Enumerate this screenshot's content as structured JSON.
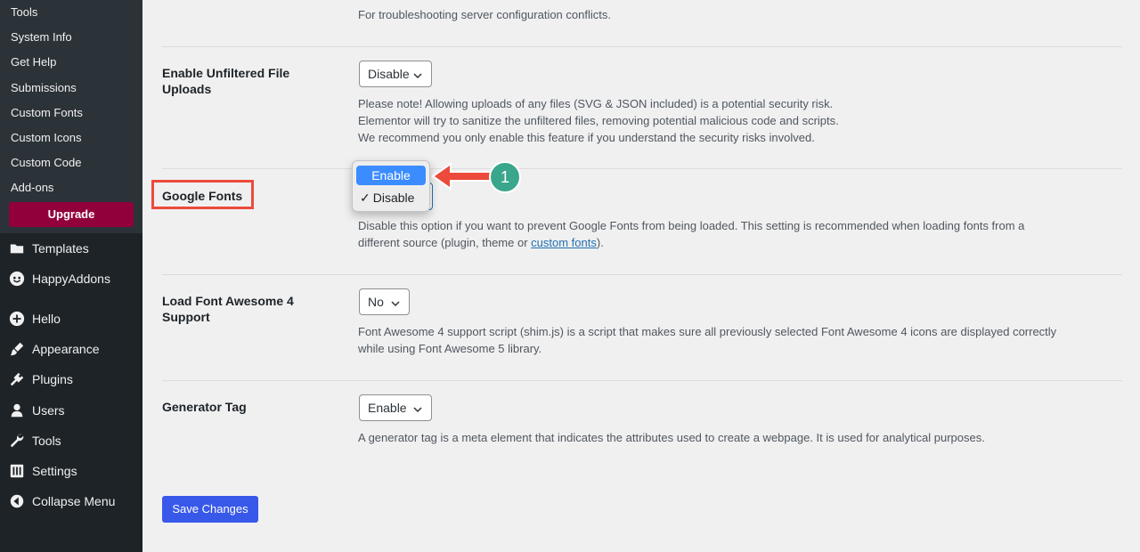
{
  "sidebar": {
    "submenu": [
      "Tools",
      "System Info",
      "Get Help",
      "Submissions",
      "Custom Fonts",
      "Custom Icons",
      "Custom Code",
      "Add-ons"
    ],
    "upgrade_label": "Upgrade",
    "menu": [
      {
        "label": "Templates",
        "icon": "folder-icon"
      },
      {
        "label": "HappyAddons",
        "icon": "happyaddons-icon"
      },
      {
        "label": "Hello",
        "icon": "plus-circle-icon"
      },
      {
        "label": "Appearance",
        "icon": "paintbrush-icon"
      },
      {
        "label": "Plugins",
        "icon": "plugin-icon"
      },
      {
        "label": "Users",
        "icon": "user-icon"
      },
      {
        "label": "Tools",
        "icon": "wrench-icon"
      },
      {
        "label": "Settings",
        "icon": "settings-icon"
      },
      {
        "label": "Collapse Menu",
        "icon": "collapse-icon"
      }
    ]
  },
  "settings": {
    "top_desc": "For troubleshooting server configuration conflicts.",
    "unfiltered": {
      "label": "Enable Unfiltered File Uploads",
      "value": "Disable",
      "desc1": "Please note! Allowing uploads of any files (SVG & JSON included) is a potential security risk.",
      "desc2": "Elementor will try to sanitize the unfiltered files, removing potential malicious code and scripts.",
      "desc3": "We recommend you only enable this feature if you understand the security risks involved."
    },
    "google_fonts": {
      "label": "Google Fonts",
      "options": [
        "Enable",
        "Disable"
      ],
      "selected": "Disable",
      "check": "✓",
      "desc_before": "Disable this option if you want to prevent Google Fonts from being loaded. This setting is recommended when loading fonts from a",
      "desc_line2": "different source (plugin, theme or ",
      "desc_link": "custom fonts",
      "desc_after": ")."
    },
    "font_awesome": {
      "label": "Load Font Awesome 4 Support",
      "value": "No",
      "desc1": "Font Awesome 4 support script (shim.js) is a script that makes sure all previously selected Font Awesome 4 icons are displayed correctly",
      "desc2": "while using Font Awesome 5 library."
    },
    "generator": {
      "label": "Generator Tag",
      "value": "Enable",
      "desc": "A generator tag is a meta element that indicates the attributes used to create a webpage. It is used for analytical purposes."
    },
    "save_label": "Save Changes"
  },
  "annotation": {
    "badge": "1"
  },
  "colors": {
    "sidebar_bg": "#1d2327",
    "upgrade_bg": "#92003b",
    "save_bg": "#3858e9",
    "highlight": "#ec4b3b",
    "badge_bg": "#3aa68b",
    "active_option": "#3b8cff",
    "link": "#2271b1"
  }
}
